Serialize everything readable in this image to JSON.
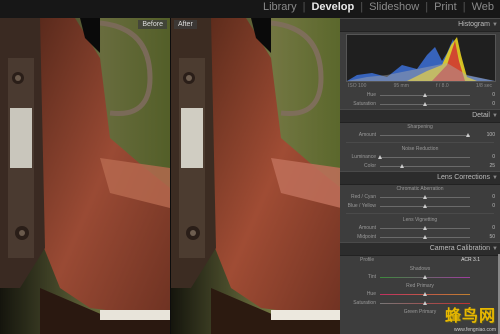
{
  "modules": [
    "Library",
    "Develop",
    "Slideshow",
    "Print",
    "Web"
  ],
  "active_module": "Develop",
  "photos": {
    "before_label": "Before",
    "after_label": "After"
  },
  "panel": {
    "histogram": {
      "title": "Histogram",
      "iso": "ISO 100",
      "focal": "95 mm",
      "aperture": "f / 8.0",
      "shutter": "1/8 sec"
    },
    "hsl": {
      "hue_label": "Hue",
      "hue_value": "0",
      "sat_label": "Saturation",
      "sat_value": "0"
    },
    "detail": {
      "title": "Detail",
      "sharpening_title": "Sharpening",
      "amount_label": "Amount",
      "amount_value": "100",
      "nr_title": "Noise Reduction",
      "lum_label": "Luminance",
      "lum_value": "0",
      "color_label": "Color",
      "color_value": "25"
    },
    "lens": {
      "title": "Lens Corrections",
      "ca_title": "Chromatic Aberration",
      "rc_label": "Red / Cyan",
      "rc_value": "0",
      "by_label": "Blue / Yellow",
      "by_value": "0",
      "vig_title": "Lens Vignetting",
      "amount_label": "Amount",
      "amount_value": "0",
      "mid_label": "Midpoint",
      "mid_value": "50"
    },
    "calibration": {
      "title": "Camera Calibration",
      "profile_label": "Profile",
      "profile_value": "ACR 3.1",
      "shadows_title": "Shadows",
      "tint_label": "Tint",
      "red_title": "Red Primary",
      "hue_label": "Hue",
      "sat_label": "Saturation",
      "green_title": "Green Primary"
    }
  },
  "watermark": {
    "text": "蜂鸟网",
    "url": "www.fengniao.com"
  }
}
